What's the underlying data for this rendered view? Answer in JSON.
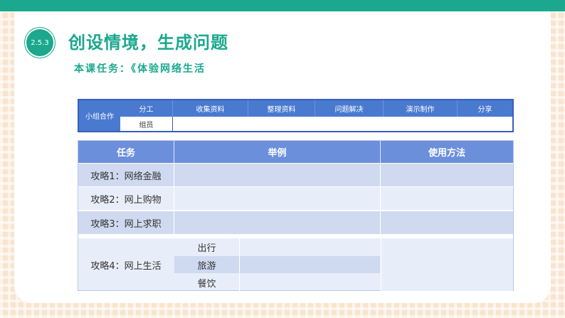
{
  "badge": "2.5.3",
  "title": "创设情境，生成问题",
  "subtitle": "本课任务：《体验网络生活",
  "group_table": {
    "row_label": "小组合作",
    "headers": [
      "分工",
      "收集资料",
      "整理资料",
      "问题解决",
      "演示制作",
      "分享"
    ],
    "member_label": "组员"
  },
  "strategy_table": {
    "headers": [
      "任务",
      "举例",
      "使用方法"
    ],
    "rows": [
      "攻略1：网络金融",
      "攻略2：网上购物",
      "攻略3：网上求职"
    ],
    "last_row": {
      "label": "攻略4：网上生活",
      "sub_items": [
        "出行",
        "旅游",
        "餐饮"
      ]
    }
  },
  "colors": {
    "accent": "#1ba88e",
    "table_header": "#4a79d0",
    "row_dark": "#cfdaf0",
    "row_light": "#e8eef9"
  }
}
